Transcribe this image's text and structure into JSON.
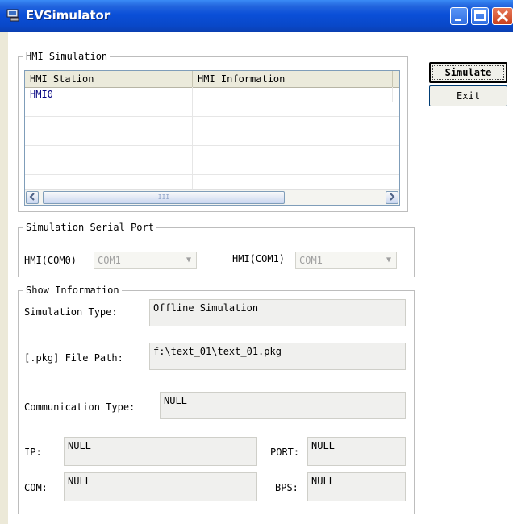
{
  "window": {
    "title": "EVSimulator"
  },
  "buttons": {
    "simulate": "Simulate",
    "exit": "Exit"
  },
  "hmi_simulation": {
    "legend": "HMI Simulation",
    "columns": [
      "HMI Station",
      "HMI Information"
    ],
    "rows": [
      {
        "station": "HMI0",
        "info": ""
      }
    ],
    "scroll_thumb_grip": "III"
  },
  "serial_port": {
    "legend": "Simulation Serial Port",
    "port0_label": "HMI(COM0)",
    "port0_value": "COM1",
    "port1_label": "HMI(COM1)",
    "port1_value": "COM1"
  },
  "show_info": {
    "legend": "Show Information",
    "sim_type_label": "Simulation Type:",
    "sim_type_value": "Offline Simulation",
    "pkg_label": "[.pkg] File Path:",
    "pkg_value": "f:\\text_01\\text_01.pkg",
    "comm_label": "Communication Type:",
    "comm_value": "NULL",
    "ip_label": "IP:",
    "ip_value": "NULL",
    "port_label": "PORT:",
    "port_value": "NULL",
    "com_label": "COM:",
    "com_value": "NULL",
    "bps_label": "BPS:",
    "bps_value": "NULL"
  },
  "colors": {
    "title_bar": "#0a4fd8",
    "station_text": "#000080",
    "frame": "#ece9d8"
  }
}
